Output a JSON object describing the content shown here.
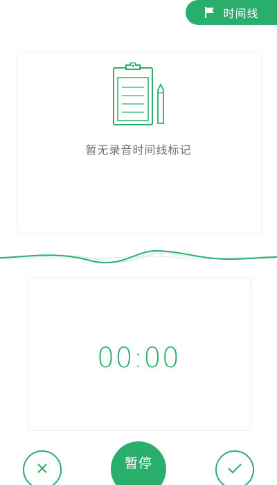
{
  "header": {
    "timeline_button_label": "时间线",
    "flag_icon": "flag-icon"
  },
  "empty_state": {
    "icon": "clipboard-pencil-icon",
    "message": "暂无录音时间线标记"
  },
  "recorder": {
    "timer": "00:00",
    "pause_label": "暂停",
    "cancel_icon": "close-icon",
    "confirm_icon": "check-icon"
  },
  "colors": {
    "accent": "#2aae6c",
    "text_muted": "#6e6e6e",
    "background": "#ffffff"
  }
}
